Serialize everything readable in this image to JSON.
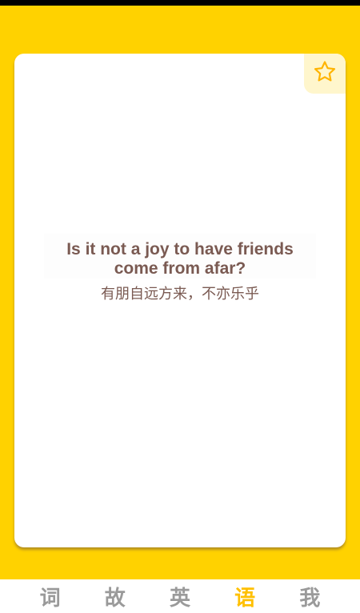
{
  "card": {
    "favorite_icon": "star-outline-icon",
    "quote_en": "Is it not a joy to have friends come from afar?",
    "quote_zh": "有朋自远方来，不亦乐乎"
  },
  "tabs": [
    {
      "label": "词",
      "active": false
    },
    {
      "label": "故",
      "active": false
    },
    {
      "label": "英",
      "active": false
    },
    {
      "label": "语",
      "active": true
    },
    {
      "label": "我",
      "active": false
    }
  ],
  "colors": {
    "background": "#ffd200",
    "accent": "#ffc000",
    "text": "#7a5a52"
  }
}
